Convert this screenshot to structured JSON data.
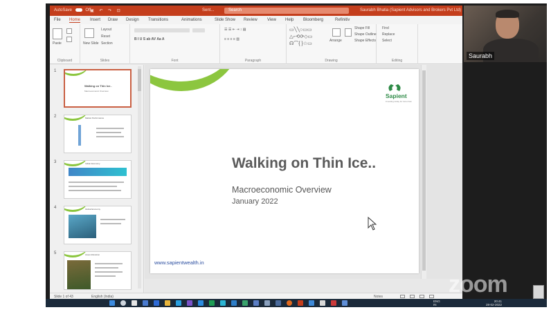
{
  "app": {
    "autosave_label": "AutoSave",
    "autosave_state": "Off",
    "doc_title": "Sent...",
    "search_placeholder": "Search",
    "user_name": "Saurabh Bhatia (Sapient Advisors and Brokers Pvt Ltd)"
  },
  "menu": {
    "tabs": [
      "File",
      "Home",
      "Insert",
      "Draw",
      "Design",
      "Transitions",
      "Animations",
      "Slide Show",
      "Review",
      "View",
      "Help",
      "Bloomberg",
      "Refinitiv"
    ],
    "active": "Home"
  },
  "ribbon": {
    "groups": [
      "Clipboard",
      "Slides",
      "Font",
      "Paragraph",
      "Drawing",
      "Editing"
    ],
    "paste": "Paste",
    "new_slide": "New Slide",
    "layout": "Layout",
    "reset": "Reset",
    "section": "Section",
    "arrange": "Arrange",
    "quick_styles": "Quick Styles",
    "shape_fill": "Shape Fill",
    "shape_outline": "Shape Outline",
    "shape_effects": "Shape Effects",
    "find": "Find",
    "replace": "Replace",
    "select": "Select"
  },
  "slide": {
    "title": "Walking on Thin Ice..",
    "subtitle": "Macroeconomic Overview",
    "date": "January 2022",
    "url": "www.sapientwealth.in",
    "logo_name": "Sapient",
    "logo_tagline": "investing today for tomorrow"
  },
  "thumbnails": [
    {
      "num": "1",
      "heading": "Walking on Thin Ice..",
      "sub": "Macroeconomic Overview"
    },
    {
      "num": "2",
      "heading": "Market Performance"
    },
    {
      "num": "3",
      "heading": "Indian Economy"
    },
    {
      "num": "4",
      "heading": "Global Economy"
    },
    {
      "num": "5",
      "heading": "Asset Allocation"
    }
  ],
  "status": {
    "slide_count": "Slide 1 of 43",
    "language": "English (India)",
    "notes": "Notes"
  },
  "video": {
    "participant": "Saurabh"
  },
  "zoom": {
    "watermark": "zoom"
  },
  "taskbar": {
    "lang_top": "ENG",
    "lang_bottom": "IN",
    "time": "20:41",
    "date": "28-02-2022"
  },
  "colors": {
    "ppt_accent": "#c43e1c",
    "logo_green": "#2d8a46",
    "arc_green": "#8cc63f"
  }
}
